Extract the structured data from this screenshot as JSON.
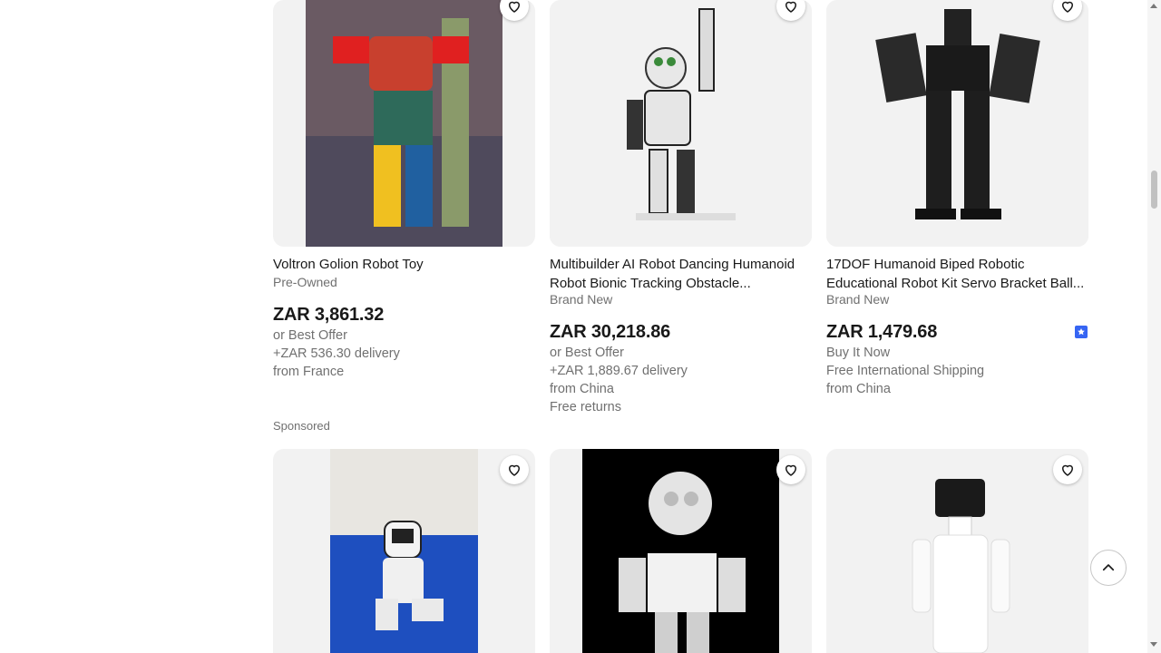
{
  "listings_top": [
    {
      "title": "Voltron Golion Robot Toy",
      "condition": "Pre-Owned",
      "price": "ZAR 3,861.32",
      "lines": [
        "or Best Offer",
        "+ZAR 536.30 delivery",
        "from France"
      ]
    },
    {
      "title_line1": "Multibuilder AI Robot Dancing Humanoid",
      "title_line2": "Robot Bionic Tracking Obstacle...",
      "condition": "Brand New",
      "price": "ZAR 30,218.86",
      "lines": [
        "or Best Offer",
        "+ZAR 1,889.67 delivery",
        "from China",
        "Free returns"
      ]
    },
    {
      "title_line1": "17DOF Humanoid Biped Robotic",
      "title_line2": "Educational Robot Kit Servo Bracket Ball...",
      "condition": "Brand New",
      "price": "ZAR 1,479.68",
      "lines": [
        "Buy It Now",
        "Free International Shipping",
        "from China"
      ],
      "badge_icon": "top-rated-seller-icon"
    }
  ],
  "sponsored_label": "Sponsored",
  "icons": {
    "heart": "heart-icon",
    "back_to_top": "chevron-up-icon"
  },
  "colors": {
    "accent_badge": "#3665f3",
    "muted_text": "#707070"
  }
}
